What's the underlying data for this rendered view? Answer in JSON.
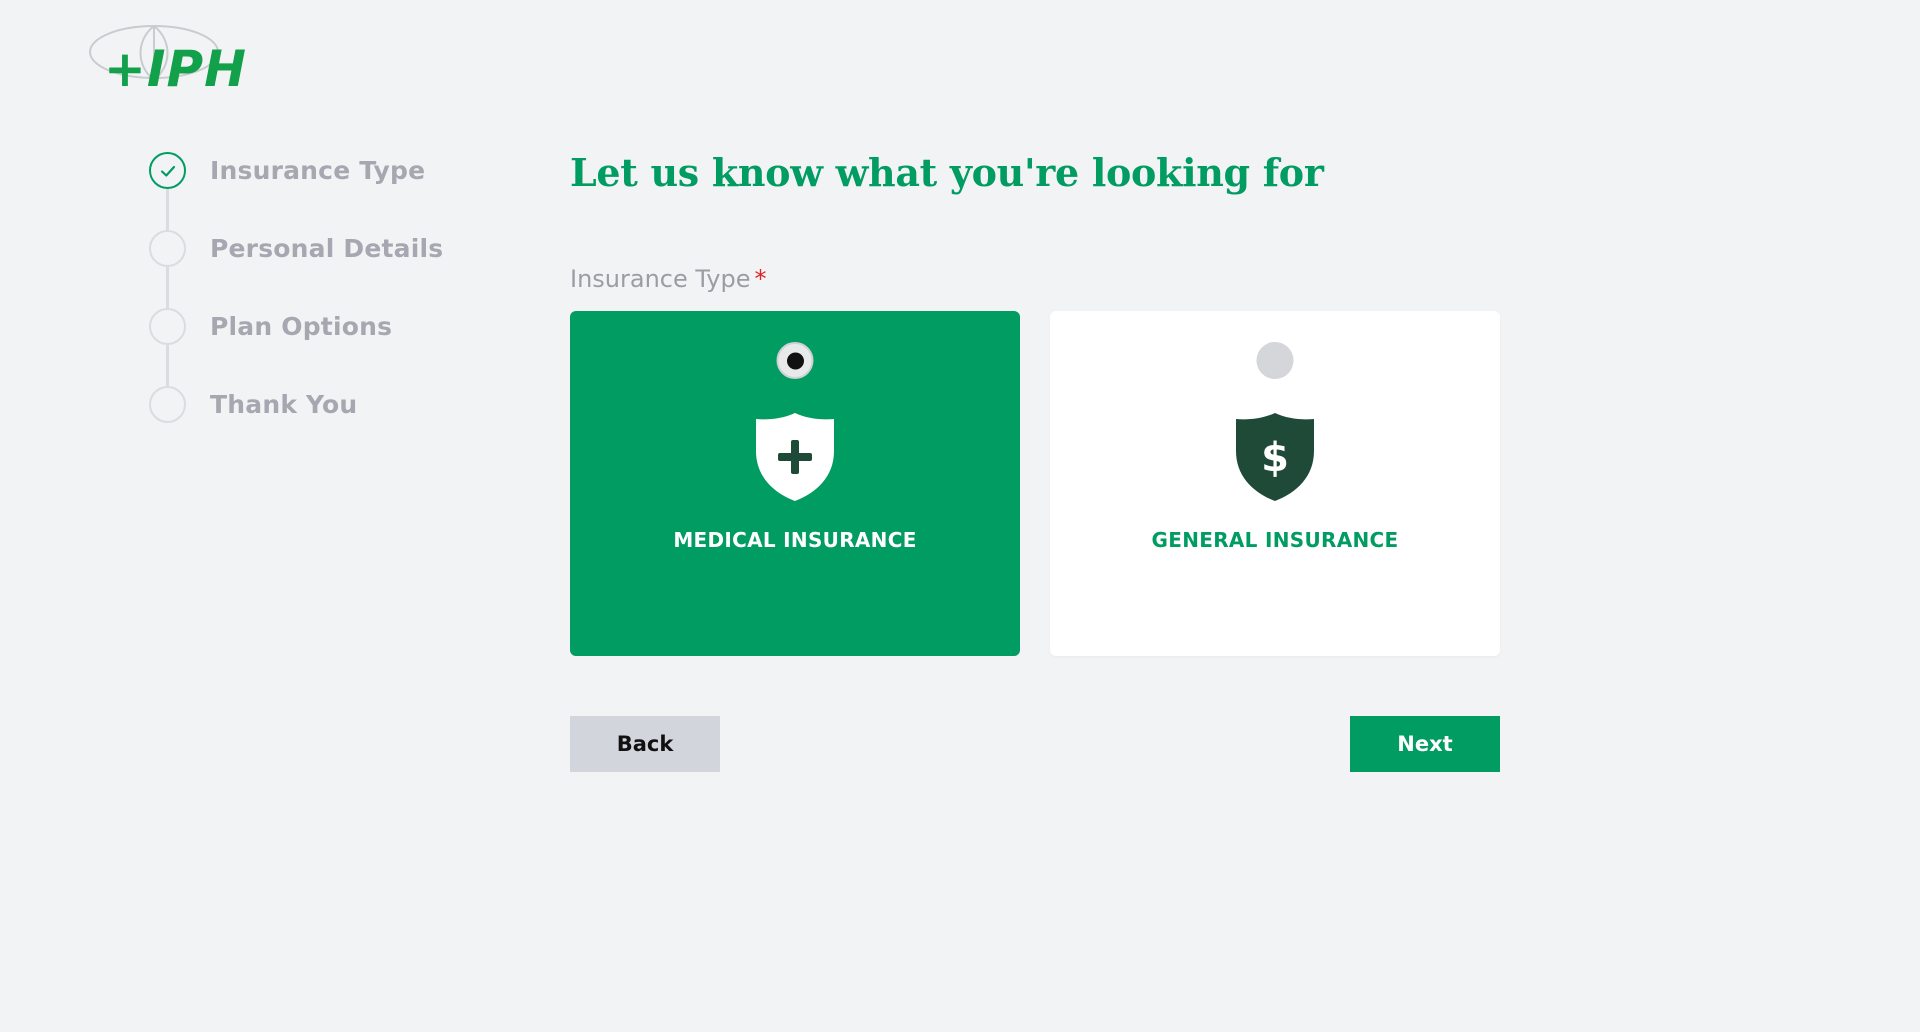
{
  "brand": {
    "logo_text": "+IPH",
    "accent_color": "#019c62"
  },
  "stepper": {
    "steps": [
      {
        "label": "Insurance Type",
        "status": "completed",
        "icon": "check-icon"
      },
      {
        "label": "Personal Details",
        "status": "pending"
      },
      {
        "label": "Plan Options",
        "status": "pending"
      },
      {
        "label": "Thank You",
        "status": "pending"
      }
    ]
  },
  "main": {
    "heading": "Let us know what you're looking for",
    "field_label": "Insurance Type",
    "required_mark": "*",
    "options": [
      {
        "label": "MEDICAL INSURANCE",
        "icon": "shield-plus-icon",
        "selected": true
      },
      {
        "label": "GENERAL INSURANCE",
        "icon": "shield-dollar-icon",
        "selected": false
      }
    ]
  },
  "actions": {
    "back_label": "Back",
    "next_label": "Next"
  }
}
